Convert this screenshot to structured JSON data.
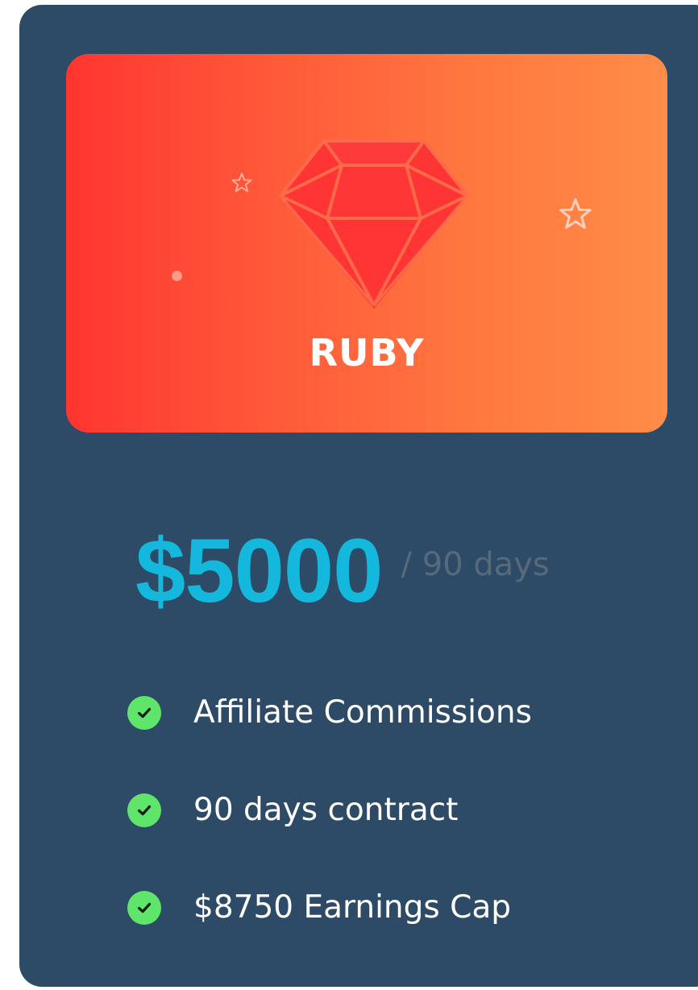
{
  "plan": {
    "name": "RUBY",
    "icon": "gem-icon",
    "price": "$5000",
    "period": "/ 90 days",
    "features": [
      {
        "label": "Affiliate Commissions",
        "icon": "check-circle-icon"
      },
      {
        "label": "90 days contract",
        "icon": "check-circle-icon"
      },
      {
        "label": "$8750 Earnings Cap",
        "icon": "check-circle-icon"
      }
    ]
  },
  "colors": {
    "card_background": "#2d4a66",
    "banner_gradient_start": "#ff3530",
    "banner_gradient_end": "#ff8c48",
    "gem": "#ff3333",
    "price": "#13b8dc",
    "period": "#566a7c",
    "check": "#5ee56a",
    "text": "#ffffff"
  }
}
